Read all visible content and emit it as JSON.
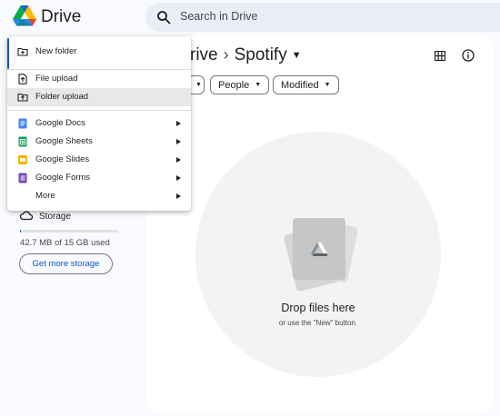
{
  "header": {
    "brand": "Drive",
    "search_placeholder": "Search in Drive"
  },
  "breadcrumb": {
    "root": "rive",
    "separator": "›",
    "current": "Spotify"
  },
  "filters": {
    "people": "People",
    "modified": "Modified"
  },
  "empty_state": {
    "title": "Drop files here",
    "subtitle": "or use the \"New\" button."
  },
  "sidebar": {
    "storage_label": "Storage",
    "storage_used": "42.7 MB of 15 GB used",
    "storage_fraction": 0.003,
    "get_storage": "Get more storage"
  },
  "new_menu": {
    "items": [
      {
        "label": "New folder",
        "icon": "new-folder-icon"
      },
      {
        "label": "File upload",
        "icon": "file-upload-icon"
      },
      {
        "label": "Folder upload",
        "icon": "folder-upload-icon",
        "highlighted": true
      },
      {
        "label": "Google Docs",
        "icon": "google-docs-icon",
        "submenu": true,
        "color": "#4285f4"
      },
      {
        "label": "Google Sheets",
        "icon": "google-sheets-icon",
        "submenu": true,
        "color": "#0f9d58"
      },
      {
        "label": "Google Slides",
        "icon": "google-slides-icon",
        "submenu": true,
        "color": "#f4b400"
      },
      {
        "label": "Google Forms",
        "icon": "google-forms-icon",
        "submenu": true,
        "color": "#7248b9"
      },
      {
        "label": "More",
        "icon": "none",
        "submenu": true
      }
    ]
  },
  "colors": {
    "accent": "#0b57d0",
    "background": "#f8fafd",
    "surface": "#ffffff",
    "search_bg": "#e9eef6"
  }
}
